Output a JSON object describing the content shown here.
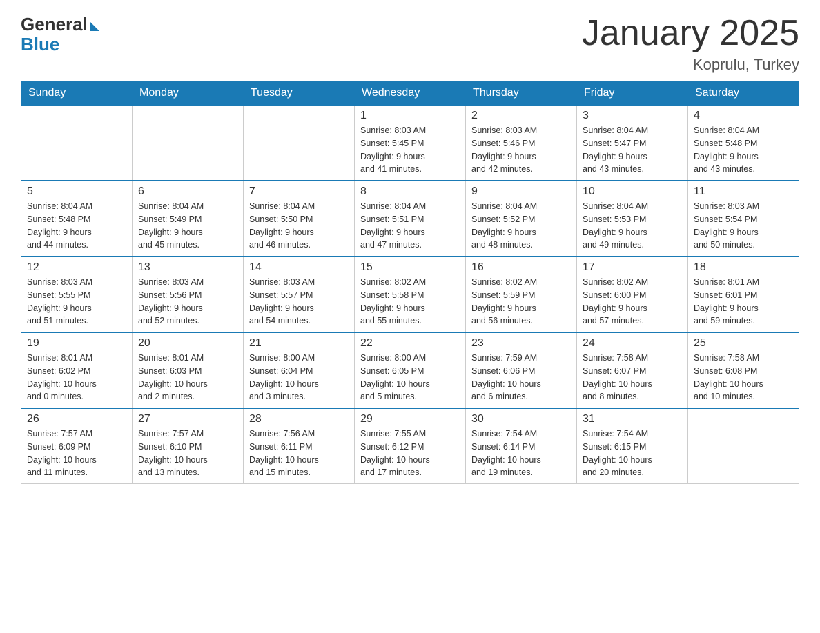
{
  "logo": {
    "general": "General",
    "blue": "Blue"
  },
  "header": {
    "title": "January 2025",
    "location": "Koprulu, Turkey"
  },
  "days_of_week": [
    "Sunday",
    "Monday",
    "Tuesday",
    "Wednesday",
    "Thursday",
    "Friday",
    "Saturday"
  ],
  "weeks": [
    [
      {
        "day": "",
        "info": ""
      },
      {
        "day": "",
        "info": ""
      },
      {
        "day": "",
        "info": ""
      },
      {
        "day": "1",
        "info": "Sunrise: 8:03 AM\nSunset: 5:45 PM\nDaylight: 9 hours\nand 41 minutes."
      },
      {
        "day": "2",
        "info": "Sunrise: 8:03 AM\nSunset: 5:46 PM\nDaylight: 9 hours\nand 42 minutes."
      },
      {
        "day": "3",
        "info": "Sunrise: 8:04 AM\nSunset: 5:47 PM\nDaylight: 9 hours\nand 43 minutes."
      },
      {
        "day": "4",
        "info": "Sunrise: 8:04 AM\nSunset: 5:48 PM\nDaylight: 9 hours\nand 43 minutes."
      }
    ],
    [
      {
        "day": "5",
        "info": "Sunrise: 8:04 AM\nSunset: 5:48 PM\nDaylight: 9 hours\nand 44 minutes."
      },
      {
        "day": "6",
        "info": "Sunrise: 8:04 AM\nSunset: 5:49 PM\nDaylight: 9 hours\nand 45 minutes."
      },
      {
        "day": "7",
        "info": "Sunrise: 8:04 AM\nSunset: 5:50 PM\nDaylight: 9 hours\nand 46 minutes."
      },
      {
        "day": "8",
        "info": "Sunrise: 8:04 AM\nSunset: 5:51 PM\nDaylight: 9 hours\nand 47 minutes."
      },
      {
        "day": "9",
        "info": "Sunrise: 8:04 AM\nSunset: 5:52 PM\nDaylight: 9 hours\nand 48 minutes."
      },
      {
        "day": "10",
        "info": "Sunrise: 8:04 AM\nSunset: 5:53 PM\nDaylight: 9 hours\nand 49 minutes."
      },
      {
        "day": "11",
        "info": "Sunrise: 8:03 AM\nSunset: 5:54 PM\nDaylight: 9 hours\nand 50 minutes."
      }
    ],
    [
      {
        "day": "12",
        "info": "Sunrise: 8:03 AM\nSunset: 5:55 PM\nDaylight: 9 hours\nand 51 minutes."
      },
      {
        "day": "13",
        "info": "Sunrise: 8:03 AM\nSunset: 5:56 PM\nDaylight: 9 hours\nand 52 minutes."
      },
      {
        "day": "14",
        "info": "Sunrise: 8:03 AM\nSunset: 5:57 PM\nDaylight: 9 hours\nand 54 minutes."
      },
      {
        "day": "15",
        "info": "Sunrise: 8:02 AM\nSunset: 5:58 PM\nDaylight: 9 hours\nand 55 minutes."
      },
      {
        "day": "16",
        "info": "Sunrise: 8:02 AM\nSunset: 5:59 PM\nDaylight: 9 hours\nand 56 minutes."
      },
      {
        "day": "17",
        "info": "Sunrise: 8:02 AM\nSunset: 6:00 PM\nDaylight: 9 hours\nand 57 minutes."
      },
      {
        "day": "18",
        "info": "Sunrise: 8:01 AM\nSunset: 6:01 PM\nDaylight: 9 hours\nand 59 minutes."
      }
    ],
    [
      {
        "day": "19",
        "info": "Sunrise: 8:01 AM\nSunset: 6:02 PM\nDaylight: 10 hours\nand 0 minutes."
      },
      {
        "day": "20",
        "info": "Sunrise: 8:01 AM\nSunset: 6:03 PM\nDaylight: 10 hours\nand 2 minutes."
      },
      {
        "day": "21",
        "info": "Sunrise: 8:00 AM\nSunset: 6:04 PM\nDaylight: 10 hours\nand 3 minutes."
      },
      {
        "day": "22",
        "info": "Sunrise: 8:00 AM\nSunset: 6:05 PM\nDaylight: 10 hours\nand 5 minutes."
      },
      {
        "day": "23",
        "info": "Sunrise: 7:59 AM\nSunset: 6:06 PM\nDaylight: 10 hours\nand 6 minutes."
      },
      {
        "day": "24",
        "info": "Sunrise: 7:58 AM\nSunset: 6:07 PM\nDaylight: 10 hours\nand 8 minutes."
      },
      {
        "day": "25",
        "info": "Sunrise: 7:58 AM\nSunset: 6:08 PM\nDaylight: 10 hours\nand 10 minutes."
      }
    ],
    [
      {
        "day": "26",
        "info": "Sunrise: 7:57 AM\nSunset: 6:09 PM\nDaylight: 10 hours\nand 11 minutes."
      },
      {
        "day": "27",
        "info": "Sunrise: 7:57 AM\nSunset: 6:10 PM\nDaylight: 10 hours\nand 13 minutes."
      },
      {
        "day": "28",
        "info": "Sunrise: 7:56 AM\nSunset: 6:11 PM\nDaylight: 10 hours\nand 15 minutes."
      },
      {
        "day": "29",
        "info": "Sunrise: 7:55 AM\nSunset: 6:12 PM\nDaylight: 10 hours\nand 17 minutes."
      },
      {
        "day": "30",
        "info": "Sunrise: 7:54 AM\nSunset: 6:14 PM\nDaylight: 10 hours\nand 19 minutes."
      },
      {
        "day": "31",
        "info": "Sunrise: 7:54 AM\nSunset: 6:15 PM\nDaylight: 10 hours\nand 20 minutes."
      },
      {
        "day": "",
        "info": ""
      }
    ]
  ]
}
